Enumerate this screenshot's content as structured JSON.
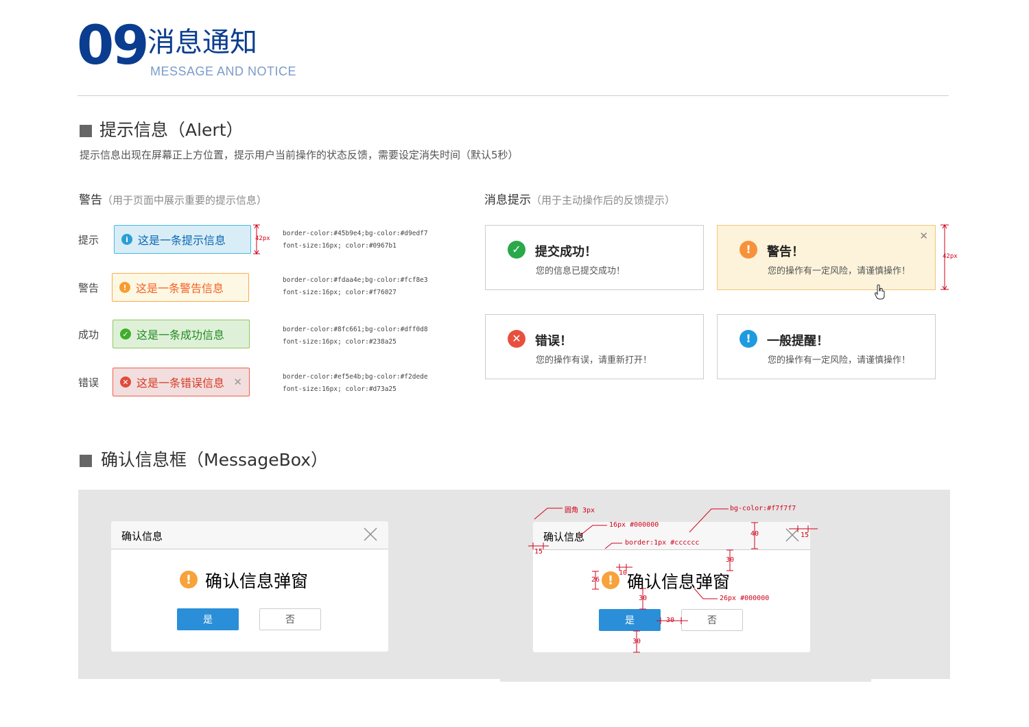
{
  "header": {
    "number": "09",
    "title_cn": "消息通知",
    "title_en": "MESSAGE AND NOTICE"
  },
  "alert_section": {
    "title": "提示信息（Alert）",
    "description": "提示信息出现在屏幕正上方位置，提示用户当前操作的状态反馈，需要设定消失时间（默认5秒）",
    "warning_group": {
      "title": "警告",
      "note": "（用于页面中展示重要的提示信息）",
      "height_annotation": "42px",
      "rows": [
        {
          "label": "提示",
          "text": "这是一条提示信息",
          "icon": "info-icon",
          "icon_glyph": "i",
          "border_color": "#45b9e4",
          "bg_color": "#d9edf7",
          "color": "#0967b1",
          "icon_color": "#2a9fd6",
          "closable": false,
          "spec_line1": "border-color:#45b9e4;bg-color:#d9edf7",
          "spec_line2": "font-size:16px; color:#0967b1"
        },
        {
          "label": "警告",
          "text": "这是一条警告信息",
          "icon": "exclamation-icon",
          "icon_glyph": "!",
          "border_color": "#fdaa4e",
          "bg_color": "#fcf8e3",
          "color": "#f76027",
          "icon_color": "#fa9b2e",
          "closable": false,
          "spec_line1": "border-color:#fdaa4e;bg-color:#fcf8e3",
          "spec_line2": "font-size:16px; color:#f76027"
        },
        {
          "label": "成功",
          "text": "这是一条成功信息",
          "icon": "check-icon",
          "icon_glyph": "✓",
          "border_color": "#8fc661",
          "bg_color": "#dff0d8",
          "color": "#238a25",
          "icon_color": "#3fae2a",
          "closable": false,
          "spec_line1": "border-color:#8fc661;bg-color:#dff0d8",
          "spec_line2": "font-size:16px; color:#238a25"
        },
        {
          "label": "错误",
          "text": "这是一条错误信息",
          "icon": "error-icon",
          "icon_glyph": "✕",
          "border_color": "#ef5e4b",
          "bg_color": "#f2dede",
          "color": "#d73a25",
          "icon_color": "#e04a3c",
          "closable": true,
          "close_glyph": "✕",
          "spec_line1": "border-color:#ef5e4b;bg-color:#f2dede",
          "spec_line2": "font-size:16px; color:#d73a25"
        }
      ]
    },
    "message_group": {
      "title": "消息提示",
      "note": "（用于主动操作后的反馈提示）",
      "height_annotation": "42px",
      "cards": [
        {
          "title": "提交成功！",
          "desc": "您的信息已提交成功！",
          "icon": "check-circle-icon",
          "icon_glyph": "✓",
          "icon_color": "#2aa84a",
          "bg": "#ffffff",
          "border": "#cccccc",
          "closable": false
        },
        {
          "title": "警告！",
          "desc": "您的操作有一定风险，请谨慎操作！",
          "icon": "exclamation-circle-icon",
          "icon_glyph": "!",
          "icon_color": "#f7923a",
          "bg": "#fcf3da",
          "border": "#f0c877",
          "closable": true,
          "close_glyph": "✕"
        },
        {
          "title": "错误！",
          "desc": "您的操作有误，请重新打开！",
          "icon": "error-circle-icon",
          "icon_glyph": "✕",
          "icon_color": "#e8503e",
          "bg": "#ffffff",
          "border": "#cccccc",
          "closable": false
        },
        {
          "title": "一般提醒！",
          "desc": "您的操作有一定风险，请谨慎操作！",
          "icon": "info-circle-icon",
          "icon_glyph": "!",
          "icon_color": "#1e9be0",
          "bg": "#ffffff",
          "border": "#cccccc",
          "closable": false
        }
      ]
    }
  },
  "messagebox_section": {
    "title": "确认信息框（MessageBox）",
    "dialog": {
      "title": "确认信息",
      "message": "确认信息弹窗",
      "yes_label": "是",
      "no_label": "否"
    },
    "annotations": {
      "radius": "圆角 3px",
      "title_font": "16px #000000",
      "bg_color": "bg-color:#f7f7f7",
      "border": "border:1px #cccccc",
      "msg_font": "26px #000000",
      "n40": "40",
      "n15a": "15",
      "n15b": "15",
      "n30a": "30",
      "n10": "10",
      "n26": "26",
      "n30b": "30",
      "n30c": "30",
      "n30d": "30"
    }
  },
  "colors": {
    "brand": "#0a3d8f",
    "brand_light": "#7a9cc8",
    "primary_button": "#2a8fd8",
    "annotation": "#d0021b"
  }
}
